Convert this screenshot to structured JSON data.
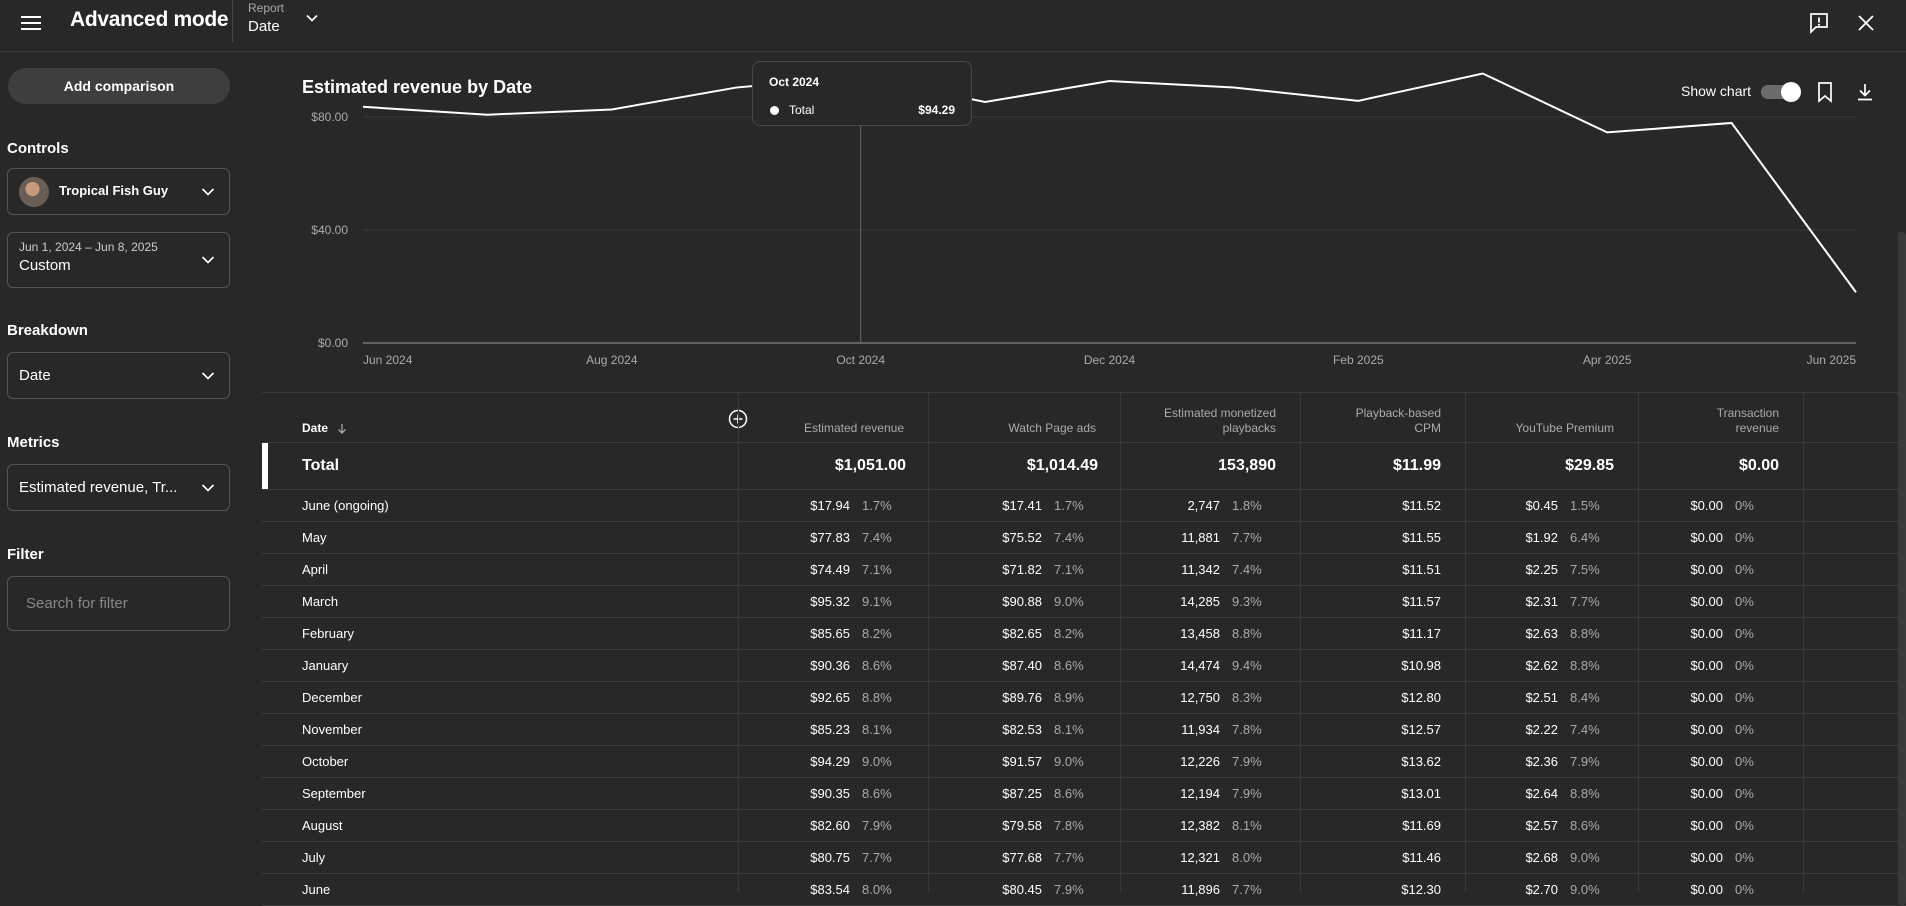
{
  "header": {
    "title": "Advanced mode",
    "report_label": "Report",
    "report_value": "Date"
  },
  "sidebar": {
    "add_comparison": "Add comparison",
    "controls_heading": "Controls",
    "channel": "Tropical Fish Guy",
    "date_range": "Jun 1, 2024 – Jun 8, 2025",
    "date_preset": "Custom",
    "breakdown_heading": "Breakdown",
    "breakdown_value": "Date",
    "metrics_heading": "Metrics",
    "metrics_value": "Estimated revenue, Tr...",
    "filter_heading": "Filter",
    "filter_placeholder": "Search for filter"
  },
  "chart": {
    "title": "Estimated revenue by Date",
    "show_chart_label": "Show chart",
    "tooltip": {
      "date": "Oct 2024",
      "series": "Total",
      "value": "$94.29"
    }
  },
  "chart_data": {
    "type": "line",
    "title": "Estimated revenue by Date",
    "x_tick_labels": [
      "Jun 2024",
      "Aug 2024",
      "Oct 2024",
      "Dec 2024",
      "Feb 2025",
      "Apr 2025",
      "Jun 2025"
    ],
    "y_tick_labels": [
      "$0.00",
      "$40.00",
      "$80.00"
    ],
    "ylim": [
      0,
      110
    ],
    "grid": true,
    "series": [
      {
        "name": "Total",
        "x": [
          "Jun 2024",
          "Jul 2024",
          "Aug 2024",
          "Sep 2024",
          "Oct 2024",
          "Nov 2024",
          "Dec 2024",
          "Jan 2025",
          "Feb 2025",
          "Mar 2025",
          "Apr 2025",
          "May 2025",
          "Jun 2025"
        ],
        "values": [
          83.54,
          80.75,
          82.6,
          90.35,
          94.29,
          85.23,
          92.65,
          90.36,
          85.65,
          95.32,
          74.49,
          77.83,
          17.94
        ]
      }
    ],
    "highlight_index": 4
  },
  "table": {
    "headers": [
      "Date",
      "Estimated revenue",
      "Watch Page ads",
      "Estimated monetized playbacks",
      "Playback-based CPM",
      "YouTube Premium",
      "Transaction revenue"
    ],
    "total": {
      "label": "Total",
      "values": [
        "$1,051.00",
        "$1,014.49",
        "153,890",
        "$11.99",
        "$29.85",
        "$0.00"
      ]
    },
    "rows": [
      {
        "label": "June (ongoing)",
        "rev": "$17.94",
        "rev_pct": "1.7%",
        "wpa": "$17.41",
        "wpa_pct": "1.7%",
        "emp": "2,747",
        "emp_pct": "1.8%",
        "cpm": "$11.52",
        "ytp": "$0.45",
        "ytp_pct": "1.5%",
        "tr": "$0.00",
        "tr_pct": "0%"
      },
      {
        "label": "May",
        "rev": "$77.83",
        "rev_pct": "7.4%",
        "wpa": "$75.52",
        "wpa_pct": "7.4%",
        "emp": "11,881",
        "emp_pct": "7.7%",
        "cpm": "$11.55",
        "ytp": "$1.92",
        "ytp_pct": "6.4%",
        "tr": "$0.00",
        "tr_pct": "0%"
      },
      {
        "label": "April",
        "rev": "$74.49",
        "rev_pct": "7.1%",
        "wpa": "$71.82",
        "wpa_pct": "7.1%",
        "emp": "11,342",
        "emp_pct": "7.4%",
        "cpm": "$11.51",
        "ytp": "$2.25",
        "ytp_pct": "7.5%",
        "tr": "$0.00",
        "tr_pct": "0%"
      },
      {
        "label": "March",
        "rev": "$95.32",
        "rev_pct": "9.1%",
        "wpa": "$90.88",
        "wpa_pct": "9.0%",
        "emp": "14,285",
        "emp_pct": "9.3%",
        "cpm": "$11.57",
        "ytp": "$2.31",
        "ytp_pct": "7.7%",
        "tr": "$0.00",
        "tr_pct": "0%"
      },
      {
        "label": "February",
        "rev": "$85.65",
        "rev_pct": "8.2%",
        "wpa": "$82.65",
        "wpa_pct": "8.2%",
        "emp": "13,458",
        "emp_pct": "8.8%",
        "cpm": "$11.17",
        "ytp": "$2.63",
        "ytp_pct": "8.8%",
        "tr": "$0.00",
        "tr_pct": "0%"
      },
      {
        "label": "January",
        "rev": "$90.36",
        "rev_pct": "8.6%",
        "wpa": "$87.40",
        "wpa_pct": "8.6%",
        "emp": "14,474",
        "emp_pct": "9.4%",
        "cpm": "$10.98",
        "ytp": "$2.62",
        "ytp_pct": "8.8%",
        "tr": "$0.00",
        "tr_pct": "0%"
      },
      {
        "label": "December",
        "rev": "$92.65",
        "rev_pct": "8.8%",
        "wpa": "$89.76",
        "wpa_pct": "8.9%",
        "emp": "12,750",
        "emp_pct": "8.3%",
        "cpm": "$12.80",
        "ytp": "$2.51",
        "ytp_pct": "8.4%",
        "tr": "$0.00",
        "tr_pct": "0%"
      },
      {
        "label": "November",
        "rev": "$85.23",
        "rev_pct": "8.1%",
        "wpa": "$82.53",
        "wpa_pct": "8.1%",
        "emp": "11,934",
        "emp_pct": "7.8%",
        "cpm": "$12.57",
        "ytp": "$2.22",
        "ytp_pct": "7.4%",
        "tr": "$0.00",
        "tr_pct": "0%"
      },
      {
        "label": "October",
        "rev": "$94.29",
        "rev_pct": "9.0%",
        "wpa": "$91.57",
        "wpa_pct": "9.0%",
        "emp": "12,226",
        "emp_pct": "7.9%",
        "cpm": "$13.62",
        "ytp": "$2.36",
        "ytp_pct": "7.9%",
        "tr": "$0.00",
        "tr_pct": "0%"
      },
      {
        "label": "September",
        "rev": "$90.35",
        "rev_pct": "8.6%",
        "wpa": "$87.25",
        "wpa_pct": "8.6%",
        "emp": "12,194",
        "emp_pct": "7.9%",
        "cpm": "$13.01",
        "ytp": "$2.64",
        "ytp_pct": "8.8%",
        "tr": "$0.00",
        "tr_pct": "0%"
      },
      {
        "label": "August",
        "rev": "$82.60",
        "rev_pct": "7.9%",
        "wpa": "$79.58",
        "wpa_pct": "7.8%",
        "emp": "12,382",
        "emp_pct": "8.1%",
        "cpm": "$11.69",
        "ytp": "$2.57",
        "ytp_pct": "8.6%",
        "tr": "$0.00",
        "tr_pct": "0%"
      },
      {
        "label": "July",
        "rev": "$80.75",
        "rev_pct": "7.7%",
        "wpa": "$77.68",
        "wpa_pct": "7.7%",
        "emp": "12,321",
        "emp_pct": "8.0%",
        "cpm": "$11.46",
        "ytp": "$2.68",
        "ytp_pct": "9.0%",
        "tr": "$0.00",
        "tr_pct": "0%"
      },
      {
        "label": "June",
        "rev": "$83.54",
        "rev_pct": "8.0%",
        "wpa": "$80.45",
        "wpa_pct": "7.9%",
        "emp": "11,896",
        "emp_pct": "7.7%",
        "cpm": "$12.30",
        "ytp": "$2.70",
        "ytp_pct": "9.0%",
        "tr": "$0.00",
        "tr_pct": "0%"
      }
    ]
  },
  "icons": {
    "menu": "hamburger-menu-icon",
    "feedback": "feedback-icon",
    "close": "close-icon",
    "bookmark": "bookmark-icon",
    "download": "download-icon",
    "add_column": "add-circle-icon",
    "sort": "arrow-down-icon"
  },
  "colors": {
    "background": "#282828",
    "line": "#ffffff",
    "grid": "#3a3a3a",
    "muted_text": "#aaaaaa"
  }
}
